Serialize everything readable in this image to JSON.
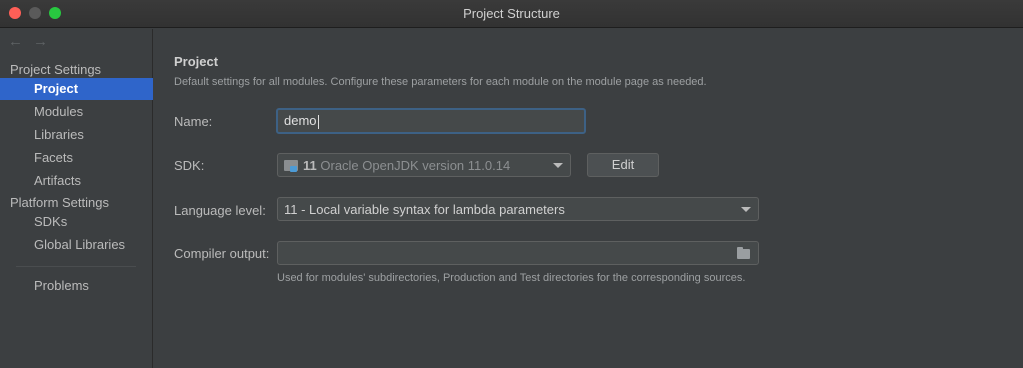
{
  "window": {
    "title": "Project Structure"
  },
  "nav": {
    "back_icon": "←",
    "forward_icon": "→"
  },
  "sidebar": {
    "project_settings_label": "Project Settings",
    "project_items": [
      {
        "label": "Project",
        "selected": true
      },
      {
        "label": "Modules"
      },
      {
        "label": "Libraries"
      },
      {
        "label": "Facets"
      },
      {
        "label": "Artifacts"
      }
    ],
    "platform_settings_label": "Platform Settings",
    "platform_items": [
      {
        "label": "SDKs"
      },
      {
        "label": "Global Libraries"
      }
    ],
    "problems_label": "Problems"
  },
  "main": {
    "heading": "Project",
    "description": "Default settings for all modules. Configure these parameters for each module on the module page as needed.",
    "name": {
      "label": "Name:",
      "value": "demo"
    },
    "sdk": {
      "label": "SDK:",
      "version": "11",
      "value": "Oracle OpenJDK version 11.0.14",
      "edit_label": "Edit"
    },
    "language_level": {
      "label": "Language level:",
      "value": "11 - Local variable syntax for lambda parameters"
    },
    "compiler_output": {
      "label": "Compiler output:",
      "value": "",
      "hint": "Used for modules' subdirectories, Production and Test directories for the corresponding sources."
    }
  },
  "colors": {
    "accent": "#2f65ca",
    "focus_border": "#3d6185",
    "background": "#3c3f41"
  }
}
